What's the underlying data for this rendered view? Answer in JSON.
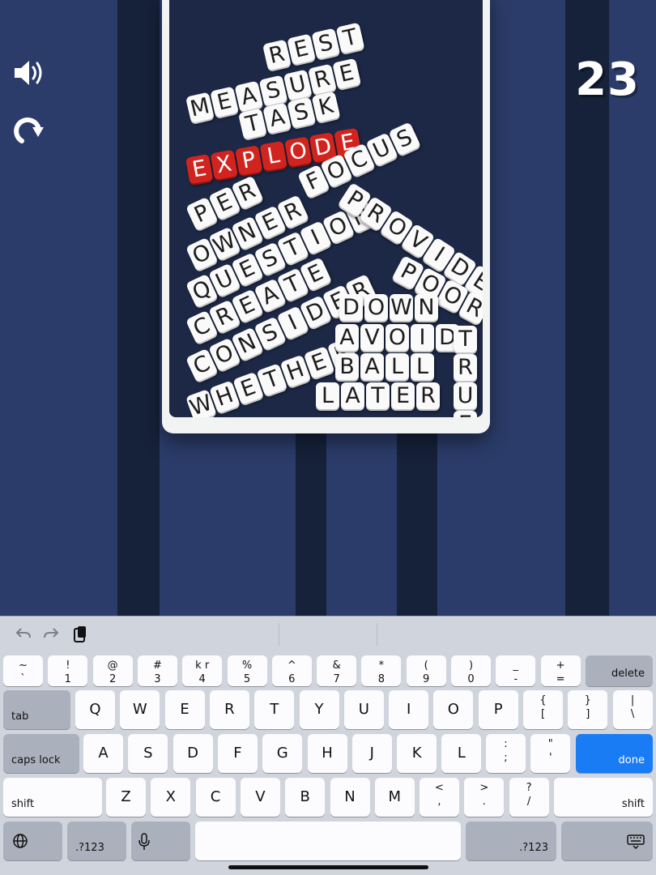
{
  "colors": {
    "background": "#2b3c6a",
    "stripe": "#16213a",
    "tile": "#fafafa",
    "highlight_tile": "#d2241e",
    "done_key": "#1a7cf5"
  },
  "score": "23",
  "icons": {
    "sound": "speaker-icon",
    "restart": "restart-icon"
  },
  "words": [
    {
      "text": "REST",
      "highlight": false
    },
    {
      "text": "MEASURE",
      "highlight": false
    },
    {
      "text": "TASK",
      "highlight": false
    },
    {
      "text": "EXPLODE",
      "highlight": true
    },
    {
      "text": "PER",
      "highlight": false
    },
    {
      "text": "FOCUS",
      "highlight": false
    },
    {
      "text": "OWNER",
      "highlight": false
    },
    {
      "text": "QUESTION",
      "highlight": false
    },
    {
      "text": "PROVIDE",
      "highlight": false
    },
    {
      "text": "CREATE",
      "highlight": false
    },
    {
      "text": "POOR",
      "highlight": false
    },
    {
      "text": "CONSIDER",
      "highlight": false
    },
    {
      "text": "DOWN",
      "highlight": false
    },
    {
      "text": "WHETHER",
      "highlight": false
    },
    {
      "text": "AVOID",
      "highlight": false
    },
    {
      "text": "TRUE",
      "highlight": false
    },
    {
      "text": "BALL",
      "highlight": false
    },
    {
      "text": "LATER",
      "highlight": false
    }
  ],
  "keyboard": {
    "toolbar": {
      "undo": "undo-icon",
      "redo": "redo-icon",
      "paste": "paste-icon"
    },
    "row1": [
      {
        "top": "~",
        "bottom": "`"
      },
      {
        "top": "!",
        "bottom": "1"
      },
      {
        "top": "@",
        "bottom": "2"
      },
      {
        "top": "#",
        "bottom": "3"
      },
      {
        "top": "k r",
        "bottom": "4"
      },
      {
        "top": "%",
        "bottom": "5"
      },
      {
        "top": "^",
        "bottom": "6"
      },
      {
        "top": "&",
        "bottom": "7"
      },
      {
        "top": "*",
        "bottom": "8"
      },
      {
        "top": "(",
        "bottom": "9"
      },
      {
        "top": ")",
        "bottom": "0"
      },
      {
        "top": "_",
        "bottom": "-"
      },
      {
        "top": "+",
        "bottom": "="
      }
    ],
    "delete": "delete",
    "tab": "tab",
    "row2": [
      "Q",
      "W",
      "E",
      "R",
      "T",
      "Y",
      "U",
      "I",
      "O",
      "P"
    ],
    "row2_sym": [
      {
        "top": "{",
        "bottom": "["
      },
      {
        "top": "}",
        "bottom": "]"
      },
      {
        "top": "|",
        "bottom": "\\"
      }
    ],
    "caps": "caps lock",
    "row3": [
      "A",
      "S",
      "D",
      "F",
      "G",
      "H",
      "J",
      "K",
      "L"
    ],
    "row3_sym": [
      {
        "top": ":",
        "bottom": ";"
      },
      {
        "top": "\"",
        "bottom": "'"
      }
    ],
    "done": "done",
    "shift": "shift",
    "row4": [
      "Z",
      "X",
      "C",
      "V",
      "B",
      "N",
      "M"
    ],
    "row4_sym": [
      {
        "top": "<",
        "bottom": ","
      },
      {
        "top": ">",
        "bottom": "."
      },
      {
        "top": "?",
        "bottom": "/"
      }
    ],
    "numbers": ".?123",
    "globe": "globe-icon",
    "mic": "microphone-icon",
    "hide": "keyboard-hide-icon"
  }
}
